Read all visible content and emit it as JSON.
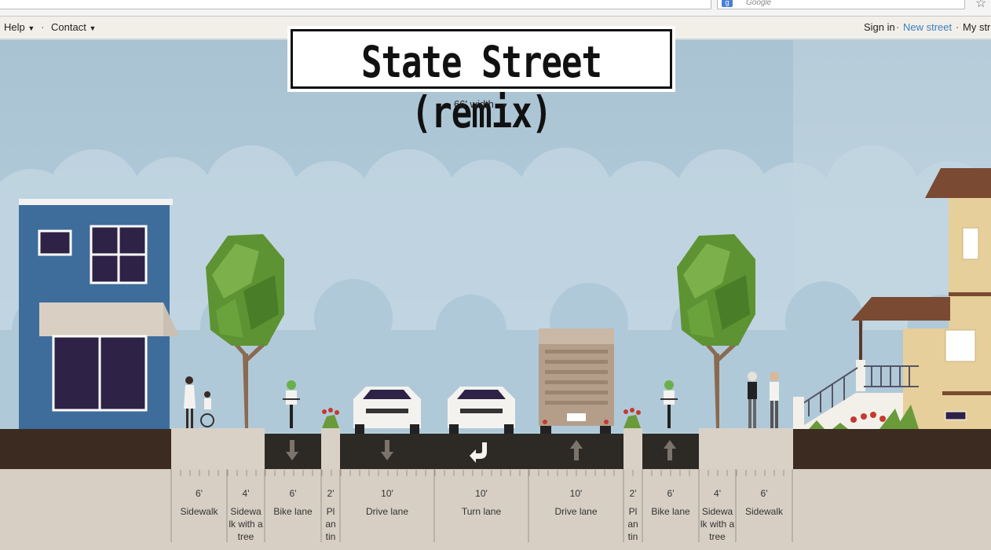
{
  "browser": {
    "search_placeholder": "Google",
    "search_engine_icon": "google-icon",
    "star_icon": "star-icon"
  },
  "nav": {
    "help": "Help",
    "contact": "Contact",
    "sign_in": "Sign in",
    "new_street": "New street",
    "my_streets": "My str"
  },
  "street": {
    "name": "State Street (remix)",
    "width": "66' width"
  },
  "colors": {
    "link": "#3a7fc1",
    "asphalt": "#2d2a25",
    "dirt": "#3b2b21",
    "sidewalk": "#d9d1c5",
    "ground": "#d7cfc3"
  },
  "segments": [
    {
      "width": "6'",
      "name": "Sidewalk"
    },
    {
      "width": "4'",
      "name": "Sidewa lk with a tree"
    },
    {
      "width": "6'",
      "name": "Bike lane"
    },
    {
      "width": "2'",
      "name": "Pl an tin"
    },
    {
      "width": "10'",
      "name": "Drive lane"
    },
    {
      "width": "10'",
      "name": "Turn lane"
    },
    {
      "width": "10'",
      "name": "Drive lane"
    },
    {
      "width": "2'",
      "name": "Pl an tin"
    },
    {
      "width": "6'",
      "name": "Bike lane"
    },
    {
      "width": "4'",
      "name": "Sidewa lk with a tree"
    },
    {
      "width": "6'",
      "name": "Sidewalk"
    }
  ]
}
